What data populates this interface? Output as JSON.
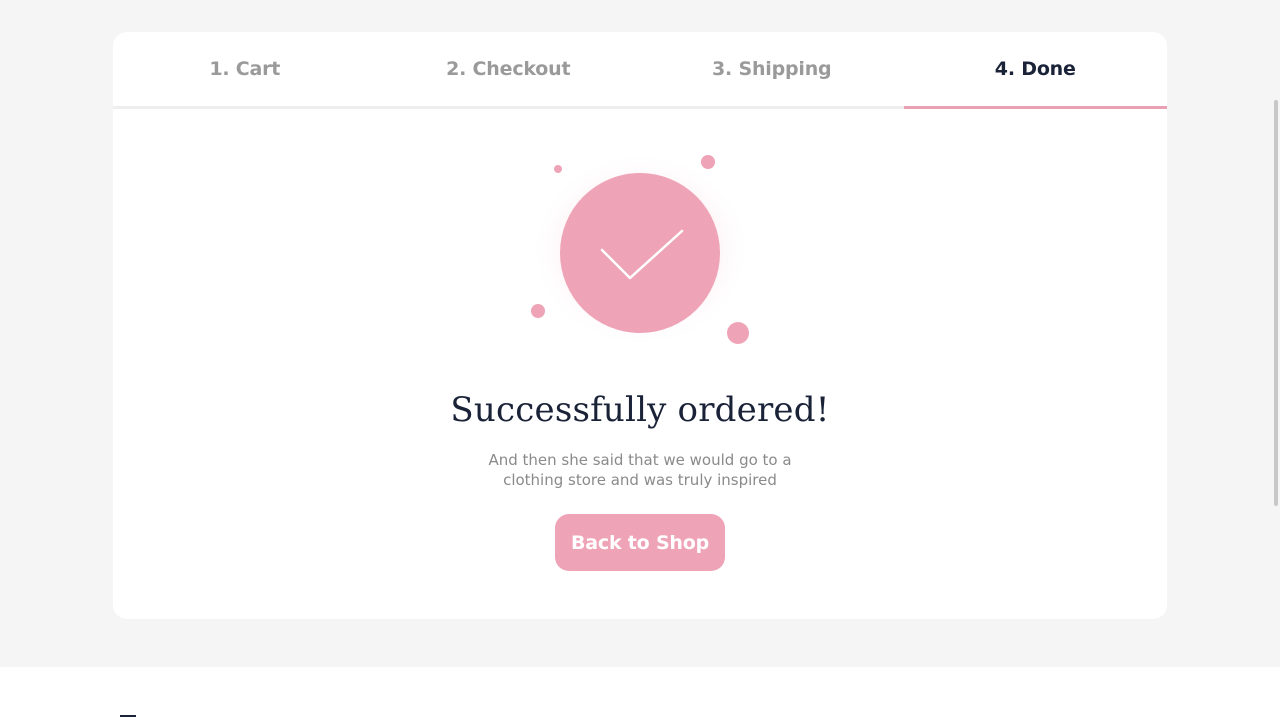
{
  "steps": [
    {
      "label": "1. Cart"
    },
    {
      "label": "2. Checkout"
    },
    {
      "label": "3. Shipping"
    },
    {
      "label": "4. Done"
    }
  ],
  "active_step": 3,
  "confirmation": {
    "title": "Successfully ordered!",
    "message": "And then she said that we would go to a clothing store and was truly inspired",
    "button_label": "Back to Shop",
    "icon": "checkmark-icon"
  },
  "colors": {
    "accent": "#eea4b6",
    "heading": "#1a2238",
    "muted": "#9a9a9a",
    "background": "#f5f5f5"
  }
}
